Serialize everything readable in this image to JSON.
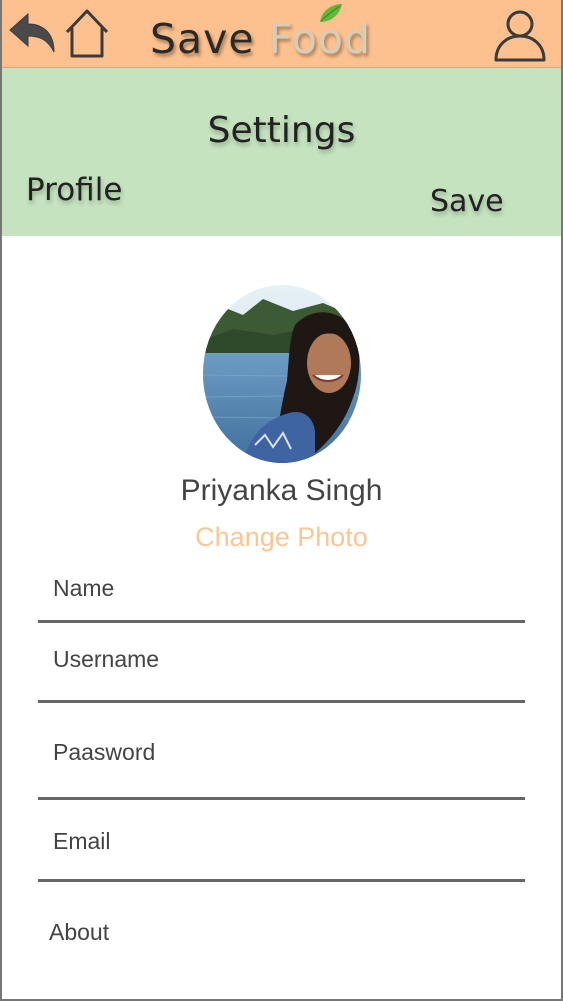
{
  "app_bar": {
    "brand_word_1": "Save",
    "brand_word_2": "Food",
    "icons": [
      "back-arrow-icon",
      "home-icon",
      "user-profile-icon",
      "leaf-icon"
    ],
    "background_color": "#fcc18e"
  },
  "settings": {
    "title": "Settings",
    "section": "Profile",
    "save_label": "Save",
    "background_color": "#c5e3bf"
  },
  "profile": {
    "user_name": "Priyanka Singh",
    "change_photo_label": "Change Photo",
    "change_photo_color": "#f9c694"
  },
  "form": {
    "fields": [
      {
        "label": "Name"
      },
      {
        "label": "Username"
      },
      {
        "label": "Paasword"
      },
      {
        "label": "Email"
      },
      {
        "label": "About"
      }
    ]
  }
}
